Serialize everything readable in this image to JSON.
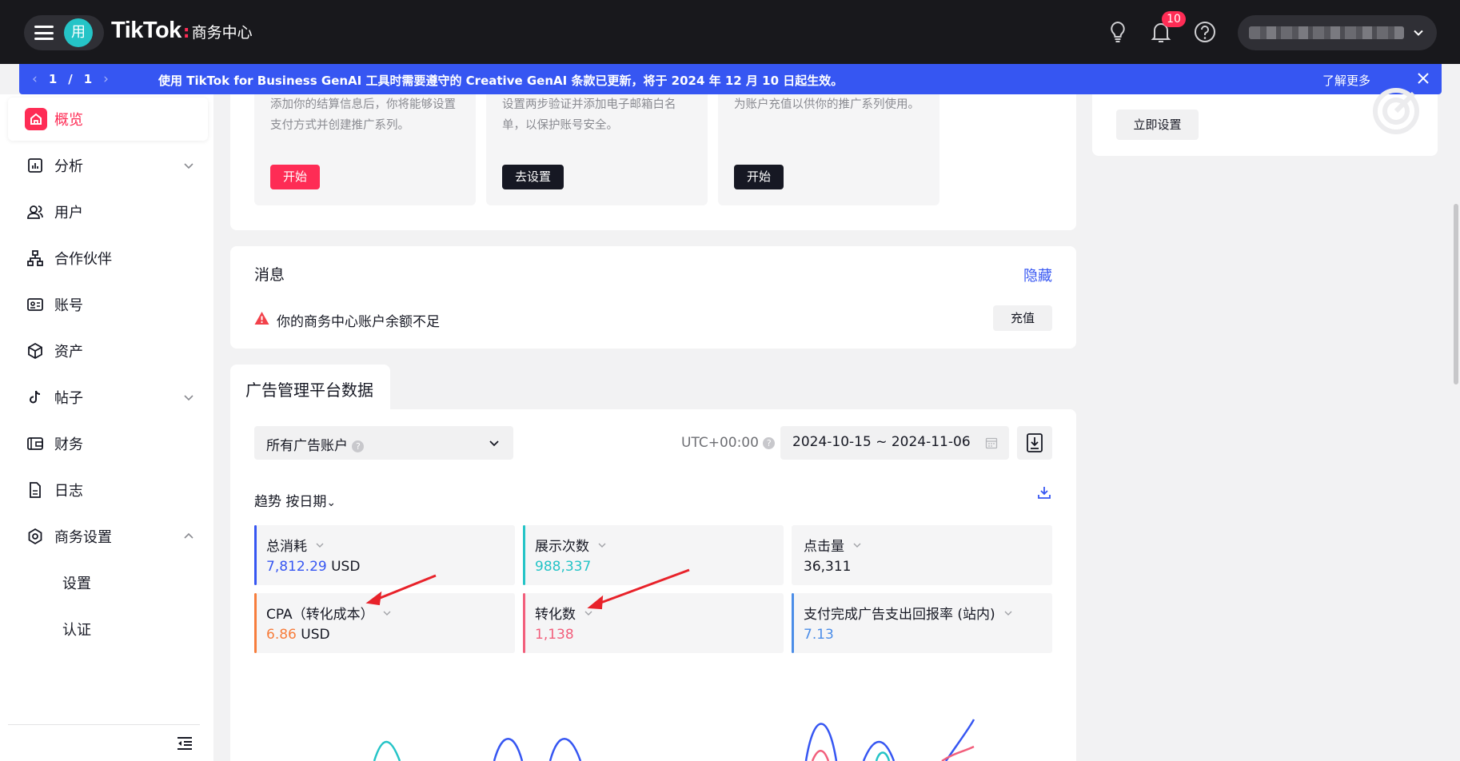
{
  "header": {
    "avatar_text": "用",
    "brand_name": "TikTok",
    "brand_sep": ":",
    "brand_sub": "商务中心",
    "notification_count": "10"
  },
  "banner": {
    "prev": "‹",
    "current_page": "1",
    "slash": "/",
    "total_pages": "1",
    "next": "›",
    "message": "使用 TikTok for Business GenAI 工具时需要遵守的 Creative GenAI 条款已更新，将于 2024 年 12 月 10 日起生效。",
    "learn_more": "了解更多"
  },
  "sidebar": {
    "items": [
      {
        "label": "概览",
        "active": true
      },
      {
        "label": "分析"
      },
      {
        "label": "用户"
      },
      {
        "label": "合作伙伴"
      },
      {
        "label": "账号"
      },
      {
        "label": "资产"
      },
      {
        "label": "帖子"
      },
      {
        "label": "财务"
      },
      {
        "label": "日志"
      },
      {
        "label": "商务设置"
      }
    ],
    "sub_items": [
      "设置",
      "认证"
    ]
  },
  "setup_cards": [
    {
      "description": "添加你的结算信息后，你将能够设置支付方式并创建推广系列。",
      "button": "开始"
    },
    {
      "description": "设置两步验证并添加电子邮箱白名单，以保护账号安全。",
      "button": "去设置"
    },
    {
      "description": "为账户充值以供你的推广系列使用。",
      "button": "开始"
    }
  ],
  "side_panel": {
    "setup_now": "立即设置"
  },
  "messages": {
    "title": "消息",
    "hide": "隐藏",
    "warning": "你的商务中心账户余额不足",
    "topup": "充值"
  },
  "ads_data": {
    "tab_label": "广告管理平台数据",
    "account_select": "所有广告账户",
    "help_glyph": "?",
    "timezone": "UTC+00:00",
    "date_range": "2024-10-15 ~ 2024-11-06",
    "trend_label": "趋势 按日期",
    "trend_caret": "⌄"
  },
  "metrics": [
    {
      "name": "总消耗",
      "value": "7,812.29",
      "unit": "USD",
      "color": "#3656f2"
    },
    {
      "name": "展示次数",
      "value": "988,337",
      "unit": "",
      "color": "#25c4c7"
    },
    {
      "name": "点击量",
      "value": "36,311",
      "unit": "",
      "color": ""
    },
    {
      "name": "CPA（转化成本）",
      "value": "6.86",
      "unit": "USD",
      "color": "#f77d3c"
    },
    {
      "name": "转化数",
      "value": "1,138",
      "unit": "",
      "color": "#f25f7c"
    },
    {
      "name": "支付完成广告支出回报率 (站内)",
      "value": "7.13",
      "unit": "",
      "color": "#4b8de8"
    }
  ],
  "colors": {
    "brand_red": "#fe2c55",
    "banner_blue": "#3656f2",
    "annotation_red": "#e8222a"
  }
}
